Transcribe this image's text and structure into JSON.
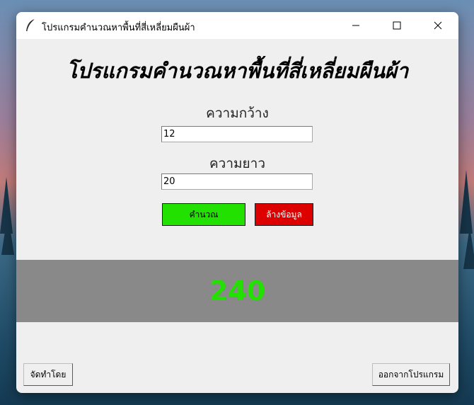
{
  "window": {
    "title": "โปรแกรมคำนวณหาพื้นที่สี่เหลี่ยมผืนผ้า"
  },
  "main": {
    "heading": "โปรแกรมคำนวณหาพื้นที่สี่เหลี่ยมผืนผ้า",
    "width_label": "ความกว้าง",
    "width_value": "12",
    "length_label": "ความยาว",
    "length_value": "20",
    "calculate_label": "คำนวณ",
    "clear_label": "ล้างข้อมูล",
    "result": "240"
  },
  "footer": {
    "credits_label": "จัดทำโดย",
    "exit_label": "ออกจากโปรแกรม"
  },
  "colors": {
    "calculate_button": "#22e000",
    "clear_button": "#dd0000",
    "result_background": "#898989",
    "result_text": "#22e000"
  },
  "icons": {
    "app": "feather-icon",
    "minimize": "minimize-icon",
    "maximize": "maximize-icon",
    "close": "close-icon"
  }
}
